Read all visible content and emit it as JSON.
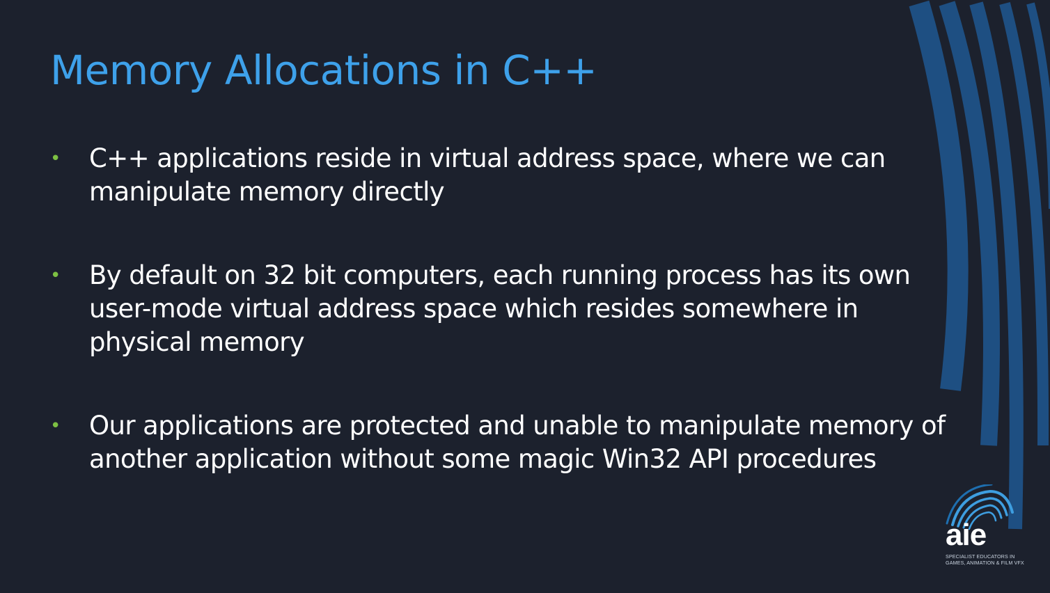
{
  "slide": {
    "title": "Memory Allocations in C++",
    "bullet_glyph": "•",
    "bullets": [
      {
        "text": "C++ applications reside in virtual address space, where we can manipulate memory directly"
      },
      {
        "text": "By default on 32 bit computers, each running process has its own user-mode virtual address space which resides somewhere in physical memory"
      },
      {
        "text": "Our applications are protected and unable to manipulate memory of another application without some magic Win32 API procedures"
      }
    ]
  },
  "logo": {
    "word": "aie",
    "tagline_1": "SPECIALIST EDUCATORS IN",
    "tagline_2": "GAMES, ANIMATION & FILM VFX"
  },
  "colors": {
    "background": "#1c212d",
    "title": "#3ea1ea",
    "body_text": "#ffffff",
    "bullet": "#7dc043",
    "arc": "#1e4f82",
    "logo_arc": "#3e9ee0"
  }
}
